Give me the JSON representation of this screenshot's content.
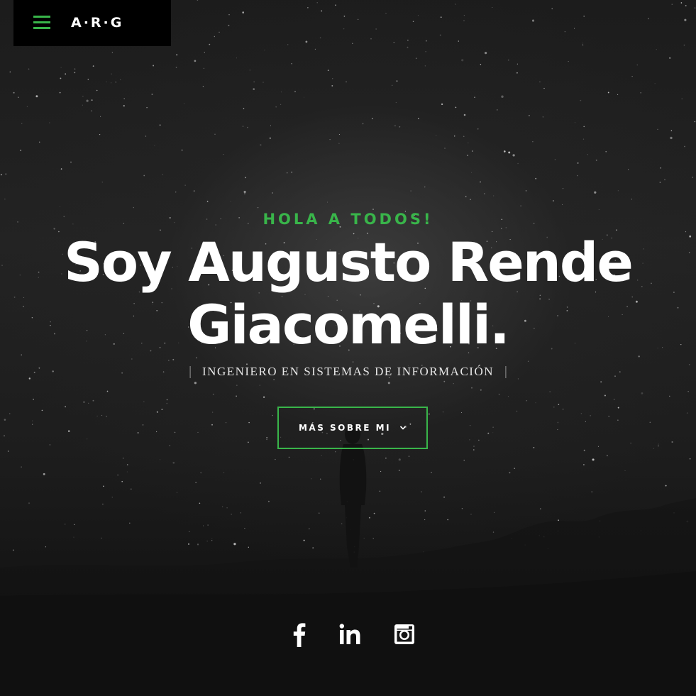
{
  "header": {
    "logo": "A·R·G",
    "menu_icon": "hamburger-menu-icon",
    "accent_color": "#39b54a"
  },
  "intro": {
    "greeting": "HOLA A TODOS!",
    "name_line1": "Soy Augusto Rende",
    "name_line2": "Giacomelli.",
    "subtitle": "INGENIERO EN SISTEMAS DE INFORMACIÓN",
    "cta_label": "MÁS SOBRE MI",
    "cta_icon": "chevron-down-icon"
  },
  "social": {
    "items": [
      {
        "name": "facebook",
        "icon": "facebook-icon"
      },
      {
        "name": "linkedin",
        "icon": "linkedin-icon"
      },
      {
        "name": "instagram",
        "icon": "instagram-icon"
      }
    ]
  }
}
